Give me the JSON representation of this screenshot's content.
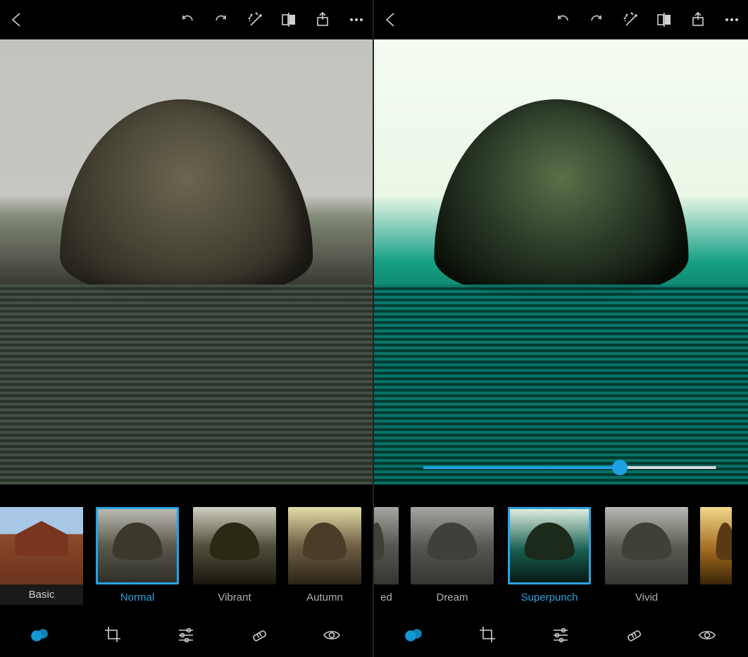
{
  "accent_color": "#1da1e3",
  "left": {
    "toolbar_icons": [
      "back",
      "undo",
      "redo",
      "auto-enhance",
      "compare",
      "share",
      "more"
    ],
    "category": {
      "label": "Basic"
    },
    "filters": [
      {
        "label": "Normal",
        "selected": true,
        "tint": "normal"
      },
      {
        "label": "Vibrant",
        "selected": false,
        "tint": "vibrant"
      },
      {
        "label": "Autumn",
        "selected": false,
        "tint": "autumn"
      }
    ],
    "dock_tools": [
      "looks",
      "crop",
      "adjust",
      "heal",
      "redeye"
    ],
    "active_tool": "looks"
  },
  "right": {
    "toolbar_icons": [
      "back",
      "undo",
      "redo",
      "auto-enhance",
      "compare",
      "share",
      "more"
    ],
    "slider": {
      "value": 67,
      "min": 0,
      "max": 100
    },
    "filters": [
      {
        "label": "ed",
        "selected": false,
        "tint": "partial-left",
        "cut": "left"
      },
      {
        "label": "Dream",
        "selected": false,
        "tint": "dream"
      },
      {
        "label": "Superpunch",
        "selected": true,
        "tint": "super"
      },
      {
        "label": "Vivid",
        "selected": false,
        "tint": "vivid"
      },
      {
        "label": "",
        "selected": false,
        "tint": "warm",
        "cut": "right"
      }
    ],
    "dock_tools": [
      "looks",
      "crop",
      "adjust",
      "heal",
      "redeye"
    ],
    "active_tool": "looks"
  }
}
